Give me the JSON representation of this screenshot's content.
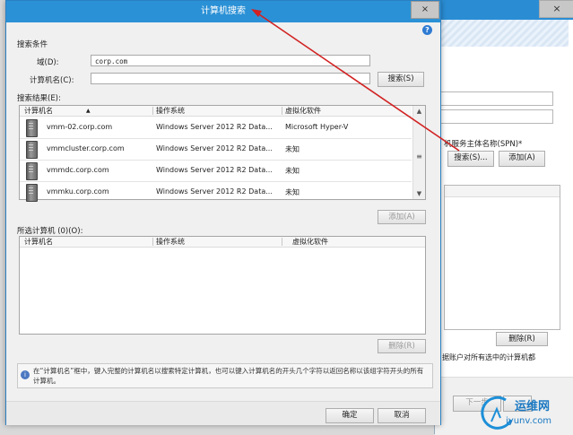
{
  "background_window": {
    "close_glyph": "×",
    "spn_label": "机服务主体名称(SPN)*",
    "search_label": "搜索(S)...",
    "add_label": "添加(A)",
    "delete_label": "删除(R)",
    "note_text": "据账户对所有选中的计算机都",
    "next_label": "下一步"
  },
  "dialog": {
    "title": "计算机搜索",
    "close_glyph": "×",
    "help_glyph": "?",
    "criteria_label": "搜索条件",
    "domain_label": "域(D):",
    "domain_value": "corp.com",
    "computer_label": "计算机名(C):",
    "computer_value": "",
    "search_button": "搜索(S)",
    "results_label": "搜索结果(E):",
    "results_columns": [
      "计算机名",
      "操作系统",
      "虚拟化软件"
    ],
    "results": [
      {
        "name": "vmm-02.corp.com",
        "os": "Windows Server 2012 R2 Data...",
        "virt": "Microsoft Hyper-V"
      },
      {
        "name": "vmmcluster.corp.com",
        "os": "Windows Server 2012 R2 Data...",
        "virt": "未知"
      },
      {
        "name": "vmmdc.corp.com",
        "os": "Windows Server 2012 R2 Data...",
        "virt": "未知"
      },
      {
        "name": "vmmku.corp.com",
        "os": "Windows Server 2012 R2 Data...",
        "virt": "未知"
      }
    ],
    "add_button": "添加(A)",
    "selected_label": "所选计算机 (0)(O):",
    "selected_columns": [
      "计算机名",
      "操作系统",
      "虚拟化软件"
    ],
    "delete_button": "删除(R)",
    "info_text": "在“计算机名”框中，键入完整的计算机名以搜索特定计算机，也可以键入计算机名的开头几个字符以返回名称以该组字符开头的所有计算机。",
    "ok_button": "确定",
    "cancel_button": "取消"
  },
  "watermark": {
    "name": "运维网",
    "url": "iyunv.com"
  },
  "colors": {
    "title_blue": "#2b91d6",
    "annotation_red": "#d22222"
  }
}
